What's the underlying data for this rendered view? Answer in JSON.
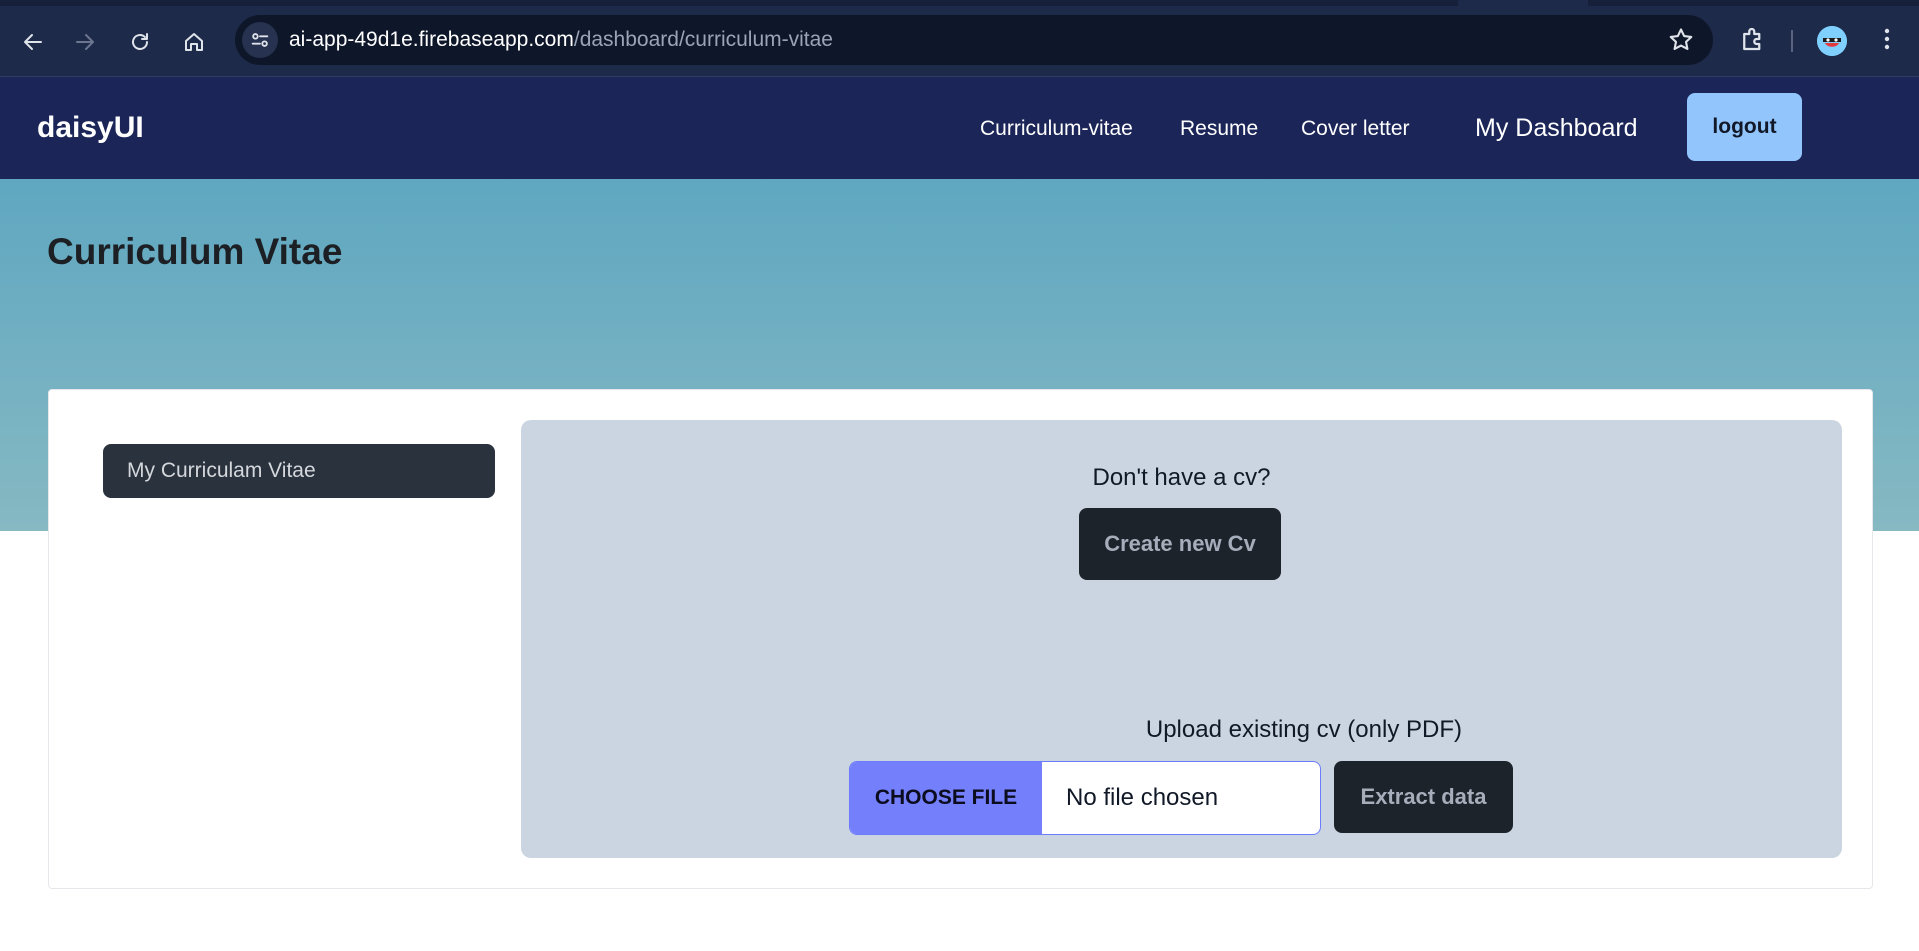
{
  "browser": {
    "url_host": "ai-app-49d1e.firebaseapp.com",
    "url_path": "/dashboard/curriculum-vitae",
    "icons": [
      "back-icon",
      "forward-icon",
      "reload-icon",
      "home-icon",
      "site-info-icon",
      "star-icon",
      "extensions-icon",
      "profile-avatar",
      "kebab-menu-icon"
    ]
  },
  "navbar": {
    "brand": "daisyUI",
    "links": [
      "Curriculum-vitae",
      "Resume",
      "Cover letter"
    ],
    "dashboard": "My Dashboard",
    "logout": "logout"
  },
  "page": {
    "title": "Curriculum Vitae"
  },
  "sidebar": {
    "items": [
      {
        "label": "My Curriculam Vitae"
      }
    ]
  },
  "panel": {
    "no_cv_text": "Don't have a cv?",
    "create_button": "Create new Cv",
    "upload_label": "Upload existing cv (only PDF)",
    "choose_file": "CHOOSE FILE",
    "file_status": "No file chosen",
    "extract_button": "Extract data"
  },
  "colors": {
    "navbar_bg": "#1b2558",
    "logout_bg": "#93c5fd",
    "panel_bg": "#cbd5e1",
    "choose_file_bg": "#747ffc",
    "dark_button_bg": "#1d232a"
  }
}
